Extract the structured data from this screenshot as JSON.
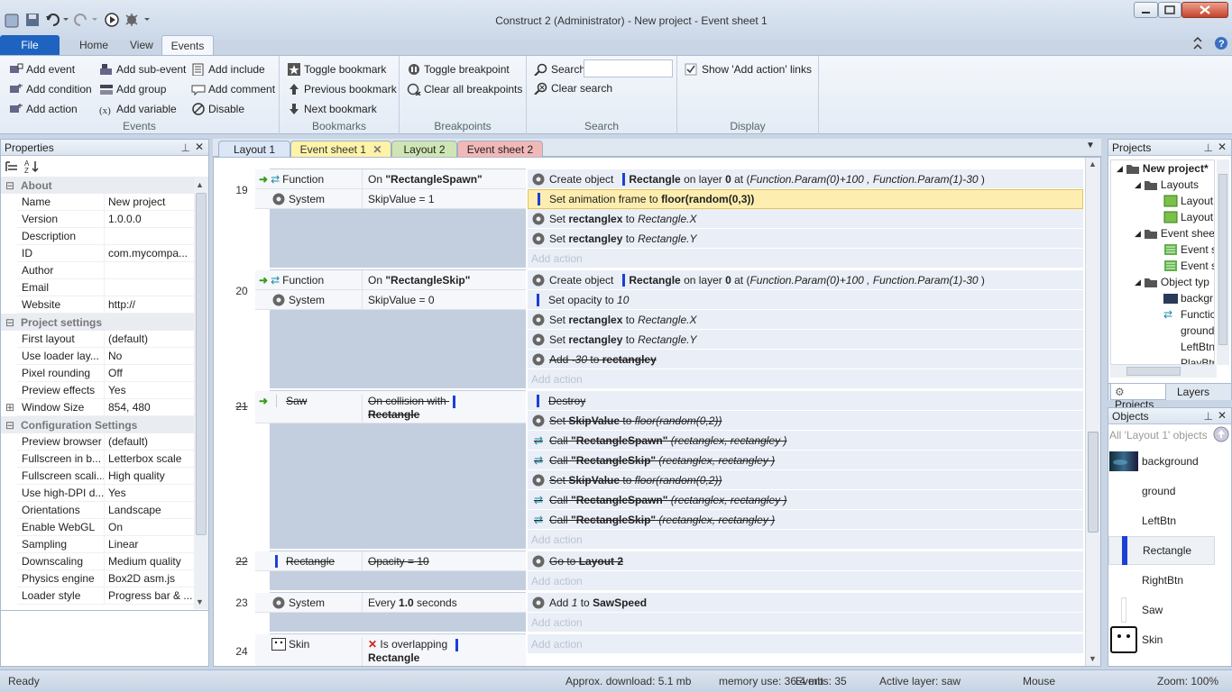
{
  "window": {
    "title": "Construct 2 (Administrator) - New project - Event sheet 1"
  },
  "ribbon": {
    "tabs": [
      "File",
      "Home",
      "View",
      "Events"
    ],
    "events_group": {
      "label": "Events",
      "add_event": "Add event",
      "add_sub_event": "Add sub-event",
      "add_include": "Add include",
      "add_condition": "Add condition",
      "add_group": "Add group",
      "add_comment": "Add comment",
      "add_action": "Add action",
      "add_variable": "Add variable",
      "disable": "Disable"
    },
    "bookmarks_group": {
      "label": "Bookmarks",
      "toggle": "Toggle bookmark",
      "previous": "Previous bookmark",
      "next": "Next bookmark"
    },
    "breakpoints_group": {
      "label": "Breakpoints",
      "toggle": "Toggle breakpoint",
      "clear_all": "Clear all breakpoints"
    },
    "search_group": {
      "label": "Search",
      "search": "Search",
      "clear": "Clear search",
      "value": ""
    },
    "display_group": {
      "label": "Display",
      "show_add_action": "Show 'Add action' links",
      "show_add_action_checked": true
    }
  },
  "properties": {
    "title": "Properties",
    "about": {
      "label": "About",
      "rows": [
        [
          "Name",
          "New project"
        ],
        [
          "Version",
          "1.0.0.0"
        ],
        [
          "Description",
          ""
        ],
        [
          "ID",
          "com.mycompa..."
        ],
        [
          "Author",
          ""
        ],
        [
          "Email",
          ""
        ],
        [
          "Website",
          "http://"
        ]
      ]
    },
    "project_settings": {
      "label": "Project settings",
      "rows": [
        [
          "First layout",
          "(default)"
        ],
        [
          "Use loader lay...",
          "No"
        ],
        [
          "Pixel rounding",
          "Off"
        ],
        [
          "Preview effects",
          "Yes"
        ],
        [
          "Window Size",
          "854, 480"
        ]
      ]
    },
    "configuration": {
      "label": "Configuration Settings",
      "rows": [
        [
          "Preview browser",
          "(default)"
        ],
        [
          "Fullscreen in b...",
          "Letterbox scale"
        ],
        [
          "Fullscreen scali...",
          "High quality"
        ],
        [
          "Use high-DPI d...",
          "Yes"
        ],
        [
          "Orientations",
          "Landscape"
        ],
        [
          "Enable WebGL",
          "On"
        ],
        [
          "Sampling",
          "Linear"
        ],
        [
          "Downscaling",
          "Medium quality"
        ],
        [
          "Physics engine",
          "Box2D asm.js"
        ],
        [
          "Loader style",
          "Progress bar & ..."
        ]
      ]
    }
  },
  "doc_tabs": {
    "layout1": "Layout 1",
    "eventsheet1": "Event sheet 1",
    "layout2": "Layout 2",
    "eventsheet2": "Event sheet 2"
  },
  "events": {
    "add_action": "Add action",
    "e19": {
      "num": "19",
      "c1_obj": "Function",
      "c1_pre": "On ",
      "c1_bold": "\"RectangleSpawn\"",
      "c2_obj": "System",
      "c2_text": "SkipValue = 1",
      "a1_pre": "Create object",
      "a1_obj": "Rectangle",
      "a1_mid": " on layer ",
      "a1_layer": "0",
      "a1_at": " at (",
      "a1_param": "Function.Param(0)+100 , Function.Param(1)-30",
      "a1_end": " )",
      "a2_pre": "Set animation frame to ",
      "a2_bold": "floor(random(0,3))",
      "a3_pre": "Set ",
      "a3_bold": "rectanglex",
      "a3_mid": " to ",
      "a3_it": "Rectangle.X",
      "a4_pre": "Set ",
      "a4_bold": "rectangley",
      "a4_mid": " to ",
      "a4_it": "Rectangle.Y"
    },
    "e20": {
      "num": "20",
      "c1_obj": "Function",
      "c1_pre": "On ",
      "c1_bold": "\"RectangleSkip\"",
      "c2_obj": "System",
      "c2_text": "SkipValue = 0",
      "a1_pre": "Create object",
      "a1_obj": "Rectangle",
      "a1_mid": " on layer ",
      "a1_layer": "0",
      "a1_at": " at (",
      "a1_param": "Function.Param(0)+100 , Function.Param(1)-30",
      "a1_end": " )",
      "a2_pre": "Set opacity to ",
      "a2_it": "10",
      "a3_pre": "Set ",
      "a3_bold": "rectanglex",
      "a3_mid": " to ",
      "a3_it": "Rectangle.X",
      "a4_pre": "Set ",
      "a4_bold": "rectangley",
      "a4_mid": " to ",
      "a4_it": "Rectangle.Y",
      "a5_pre": "Add ",
      "a5_it": "-30",
      "a5_mid": " to ",
      "a5_bold": "rectangley"
    },
    "e21": {
      "num": "21",
      "c1_obj": "Saw",
      "c1_text": "On collision with",
      "c1_bold": "Rectangle",
      "a1": "Destroy",
      "a2_pre": "Set ",
      "a2_bold": "SkipValue",
      "a2_mid": " to ",
      "a2_it": "floor(random(0,2))",
      "a3_pre": "Call ",
      "a3_bold": "\"RectangleSpawn\"",
      "a3_it": " (rectanglex, rectangley )",
      "a4_pre": "Call ",
      "a4_bold": "\"RectangleSkip\"",
      "a4_it": " (rectanglex, rectangley )",
      "a5_pre": "Set ",
      "a5_bold": "SkipValue",
      "a5_mid": " to ",
      "a5_it": "floor(random(0,2))",
      "a6_pre": "Call ",
      "a6_bold": "\"RectangleSpawn\"",
      "a6_it": " (rectanglex, rectangley )",
      "a7_pre": "Call ",
      "a7_bold": "\"RectangleSkip\"",
      "a7_it": " (rectanglex, rectangley )"
    },
    "e22": {
      "num": "22",
      "c1_obj": "Rectangle",
      "c1_text": "Opacity = 10",
      "a1_pre": "Go to ",
      "a1_bold": "Layout 2"
    },
    "e23": {
      "num": "23",
      "c1_obj": "System",
      "c1_pre": "Every ",
      "c1_bold": "1.0",
      "c1_post": " seconds",
      "a1_pre": "Add ",
      "a1_it": "1",
      "a1_mid": " to ",
      "a1_bold": "SawSpeed"
    },
    "e24": {
      "num": "24",
      "c1_obj": "Skin",
      "c1_text": "Is overlapping",
      "c1_bold": "Rectangle"
    }
  },
  "projects": {
    "title": "Projects",
    "root": "New project*",
    "layouts": "Layouts",
    "layout_a": "Layout",
    "layout_b": "Layout",
    "event_sheets": "Event shee",
    "es_a": "Event s",
    "es_b": "Event s",
    "object_types": "Object typ",
    "ot": [
      "backgr",
      "Functic",
      "ground",
      "LeftBtn",
      "PlayBtr"
    ],
    "tab_projects": "Projects",
    "tab_layers": "Layers"
  },
  "objects": {
    "title": "Objects",
    "filter": "All 'Layout 1' objects",
    "items": [
      "background",
      "ground",
      "LeftBtn",
      "Rectangle",
      "RightBtn",
      "Saw",
      "Skin"
    ]
  },
  "status": {
    "ready": "Ready",
    "download": "Approx. download: 5.1 mb",
    "memory": "memory use: 36.4 mb",
    "events": "Events: 35",
    "layer": "Active layer: saw",
    "mouse": "Mouse",
    "zoom": "Zoom: 100%"
  }
}
